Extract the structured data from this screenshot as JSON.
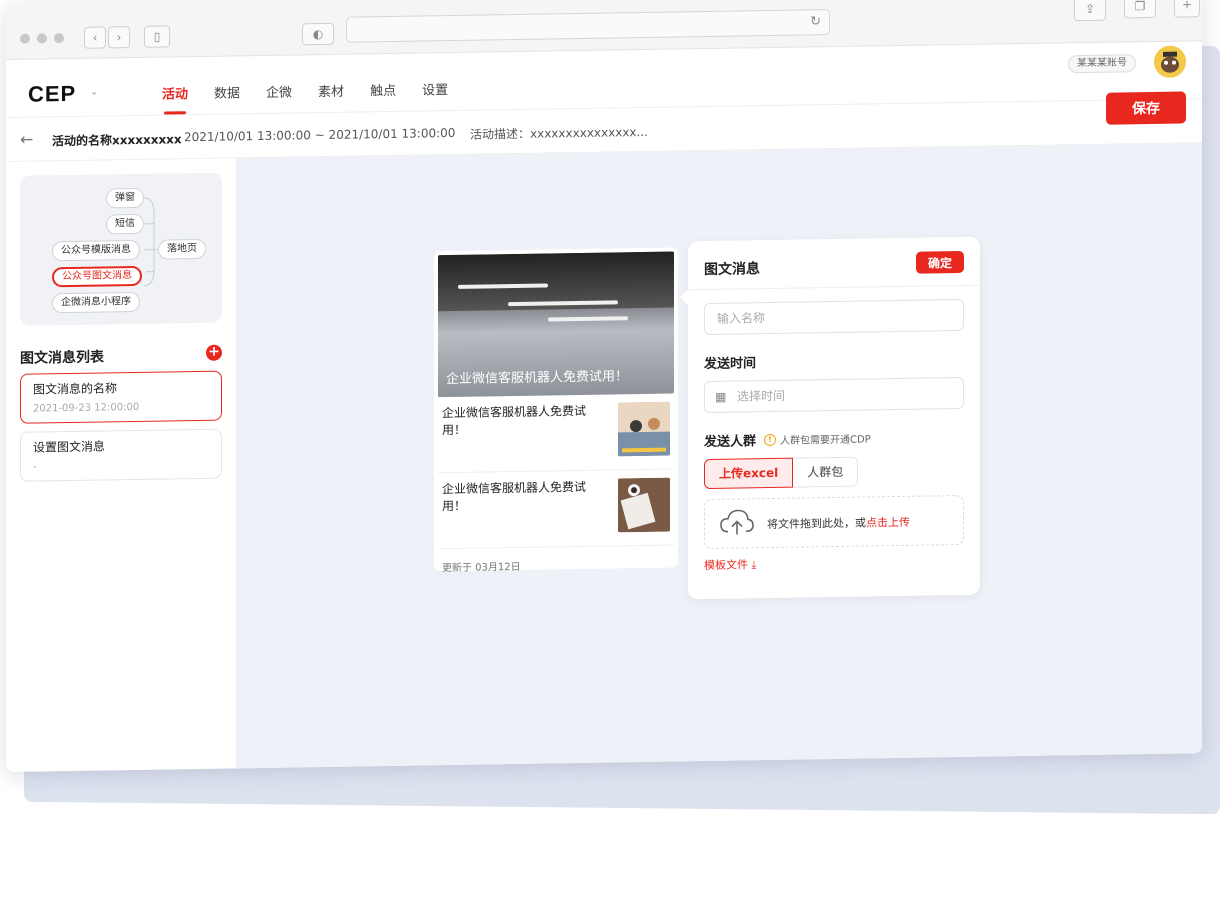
{
  "browser": {
    "reload_icon": "↻"
  },
  "brand": {
    "logo": "CEP"
  },
  "nav": {
    "tabs": [
      "活动",
      "数据",
      "企微",
      "素材",
      "触点",
      "设置"
    ],
    "active": 0
  },
  "account": {
    "name": "某某某账号"
  },
  "toolbar": {
    "save_label": "保存"
  },
  "activity": {
    "name": "活动的名称xxxxxxxxx",
    "time_range": "2021/10/01  13:00:00  ~ 2021/10/01  13:00:00",
    "description": "活动描述：xxxxxxxxxxxxxxx..."
  },
  "flow": {
    "nodes": [
      "弹窗",
      "短信",
      "公众号模版消息",
      "公众号图文消息",
      "企微消息小程序"
    ],
    "target": "落地页",
    "selected_index": 3
  },
  "list": {
    "title": "图文消息列表",
    "items": [
      {
        "title": "图文消息的名称",
        "subtitle": "2021-09-23  12:00:00"
      },
      {
        "title": "设置图文消息",
        "subtitle": "-"
      }
    ]
  },
  "preview": {
    "hero_caption": "企业微信客服机器人免费试用！",
    "articles": [
      {
        "title": "企业微信客服机器人免费试用！"
      },
      {
        "title": "企业微信客服机器人免费试用！"
      }
    ],
    "updated": "更新于 03月12日"
  },
  "panel": {
    "title": "图文消息",
    "confirm_label": "确定",
    "name_placeholder": "输入名称",
    "send_time_label": "发送时间",
    "time_placeholder": "选择时间",
    "audience_label": "发送人群",
    "audience_hint": "人群包需要开通CDP",
    "upload_tab": "上传excel",
    "package_tab": "人群包",
    "drop_text": "将文件拖到此处，或",
    "drop_link": "点击上传",
    "template_link": "模板文件"
  },
  "colors": {
    "accent": "#e8281f",
    "canvas": "#eef1f7"
  }
}
